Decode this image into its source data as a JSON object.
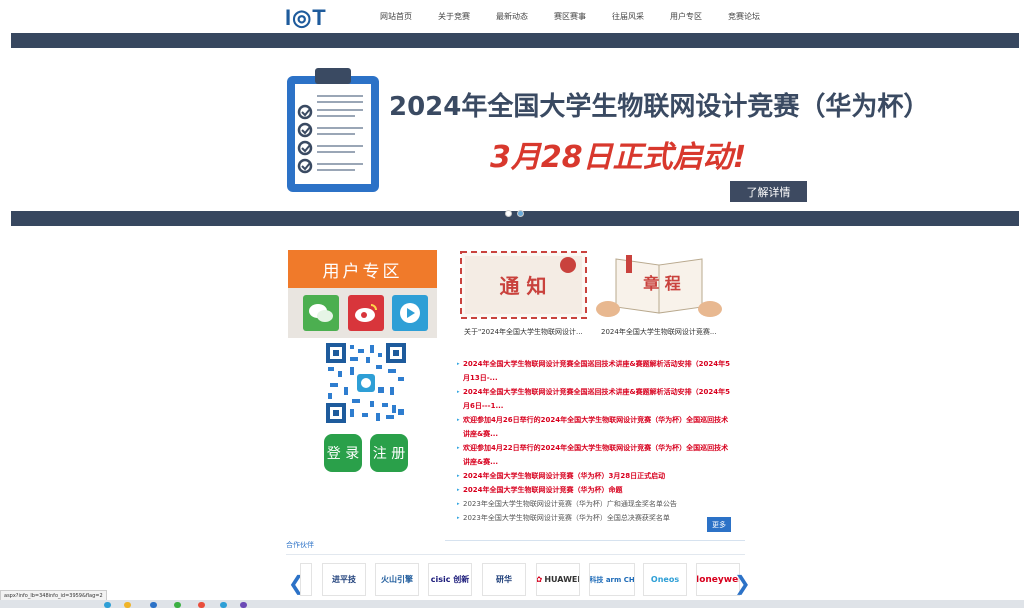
{
  "header": {
    "logo": "I◎T",
    "nav": [
      "网站首页",
      "关于竞赛",
      "最新动态",
      "赛区赛事",
      "往届风采",
      "用户专区",
      "竞赛论坛"
    ]
  },
  "banner": {
    "title": "2024年全国大学生物联网设计竞赛（华为杯）",
    "subtitle": "3月28日正式启动!",
    "button": "了解详情"
  },
  "user_zone": {
    "title": "用户专区",
    "login": "登 录",
    "register": "注 册"
  },
  "tiles": [
    {
      "label": "通 知",
      "caption": "关于\"2024年全国大学生物联网设计..."
    },
    {
      "label": "章 程",
      "caption": "2024年全国大学生物联网设计竞赛..."
    }
  ],
  "news": [
    {
      "text": "2024年全国大学生物联网设计竞赛全国巡回技术讲座&赛题解析活动安排（2024年5月13日-...",
      "hot": true
    },
    {
      "text": "2024年全国大学生物联网设计竞赛全国巡回技术讲座&赛题解析活动安排（2024年5月6日---1...",
      "hot": true
    },
    {
      "text": "欢迎参加4月26日举行的2024年全国大学生物联网设计竞赛（华为杯）全国巡回技术讲座&赛...",
      "hot": true
    },
    {
      "text": "欢迎参加4月22日举行的2024年全国大学生物联网设计竞赛（华为杯）全国巡回技术讲座&赛...",
      "hot": true
    },
    {
      "text": "2024年全国大学生物联网设计竞赛（华为杯）3月28日正式启动",
      "hot": true
    },
    {
      "text": "2024年全国大学生物联网设计竞赛（华为杯）命题",
      "hot": true
    },
    {
      "text": "2023年全国大学生物联网设计竞赛（华为杯）广和通现金奖名单公告",
      "hot": false
    },
    {
      "text": "2023年全国大学生物联网设计竞赛（华为杯）全国总决赛获奖名单",
      "hot": false
    }
  ],
  "more": "更多",
  "partners": {
    "title": "合作伙伴",
    "logos": [
      "进平技",
      "火山引擎",
      "cisic 创新",
      "研华",
      "HUAWEI",
      "安谋科技 arm CHINA",
      "Oneos",
      "Honeywell"
    ]
  },
  "status_url": "aspx?info_lb=348info_id=3959&flag=2"
}
